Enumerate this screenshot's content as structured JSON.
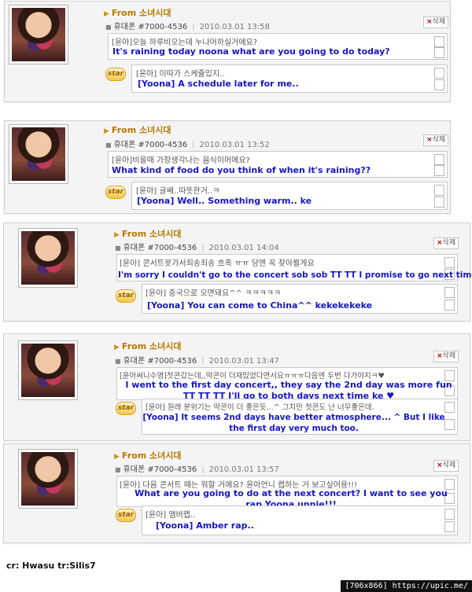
{
  "posts": [
    {
      "from_label": "From 소녀시대",
      "phone": "휴대폰 #7000-4536",
      "date": "2010.03.01 13:58",
      "delete_label": "삭제",
      "message_ko": "[윤아]오늘 하루비오는데 누나머하실거에요?",
      "message_en": "It's raining today noona what are you going to do today?",
      "reply_ko": "[윤아] 이따가 스케쥴있지..",
      "reply_en": "[Yoona] A schedule later for me..",
      "star_label": "star"
    },
    {
      "from_label": "From 소녀시대",
      "phone": "휴대폰 #7000-4536",
      "date": "2010.03.01 13:52",
      "delete_label": "삭제",
      "message_ko": "[윤아]비올때 가장생각나는 음식이머에요?",
      "message_en": "What kind of food do you think of when it's raining??",
      "reply_ko": "[윤아] 글쎄..따뜻한거..ㅋ",
      "reply_en": "[Yoona] Well.. Something warm.. ke",
      "star_label": "star"
    },
    {
      "from_label": "From 소녀시대",
      "phone": "휴대폰 #7000-4536",
      "date": "2010.03.01 14:04",
      "delete_label": "삭제",
      "message_ko": "[윤아] 콘서트못가서죄송죄송 흐흑 ㅠㅠ 담엔 꼭 찾아뵐게요",
      "message_en": "I'm sorry I couldn't go to the concert sob sob TT TT I promise to go next time",
      "reply_ko": "[윤아] 중국으로 오면돼요^^ ㅋㅋㅋㅋㅋ",
      "reply_en": "[Yoona] You can come to China^^ kekekekeke",
      "star_label": "star"
    },
    {
      "from_label": "From 소녀시대",
      "phone": "휴대폰 #7000-4536",
      "date": "2010.03.01 13:47",
      "delete_label": "삭제",
      "message_ko": "[윤아써니수영]첫콘갔는데,,막콘이 더재밌었다면서요ㅠㅠㅠ다음엔 두번 다가야지ㅋ♥",
      "message_en": "I went to the first day concert,, they say the 2nd day was more fun TT TT TT I'll go to both days next time ke ♥",
      "reply_ko": "[윤아] 원래 분위기는 막콘이 더 좋은듯...^ 그치만 첫콘도 난 너무좋은데.",
      "reply_en": "[Yoona] It seems 2nd days have better atmosphere... ^ But I like the first day very much too.",
      "star_label": "star"
    },
    {
      "from_label": "From 소녀시대",
      "phone": "휴대폰 #7000-4536",
      "date": "2010.03.01 13:57",
      "delete_label": "삭제",
      "message_ko": "[윤아] 다음 콘서트 때는 뭐할 거예요? 윤아언니 랩하는 거 보고싶어용!!!",
      "message_en": "What are you going to do at the next concert? I want to see you rap Yoona unnie!!!",
      "reply_ko": "[윤아] 앰버랩..",
      "reply_en": "[Yoona] Amber rap..",
      "star_label": "star"
    }
  ],
  "credit": "cr: Hwasu  tr:Silis7",
  "watermark": "[706x866] https://upic.me/"
}
